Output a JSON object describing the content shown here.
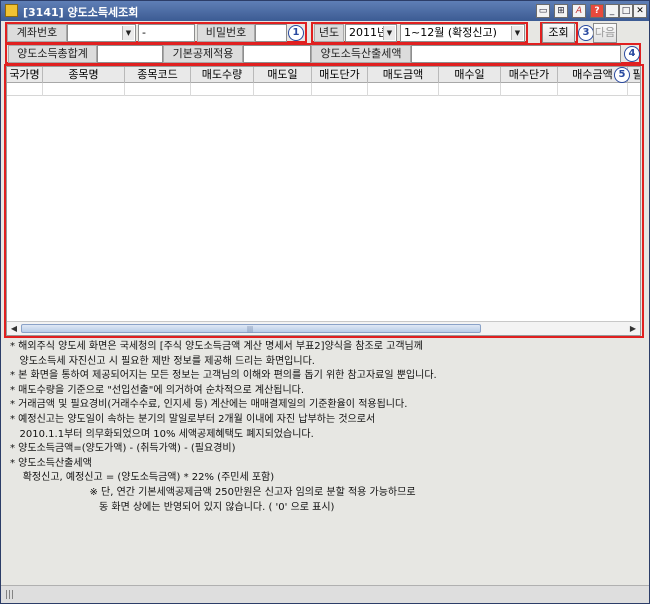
{
  "window": {
    "title": "[3141] 양도소득세조회",
    "buttons": [
      "restore-icon",
      "pin-icon",
      "font-icon",
      "help-icon",
      "minimize-icon",
      "maximize-icon",
      "close-icon"
    ]
  },
  "account": {
    "account_label": "계좌번호",
    "account_value": "",
    "sub_value": "-",
    "password_label": "비밀번호",
    "password_value": "",
    "marker": "1"
  },
  "period": {
    "year_label": "년도",
    "year_value": "2011년",
    "range_value": "1~12월 (확정신고)",
    "marker": "2"
  },
  "actions": {
    "query_label": "조회",
    "next_label": "다음",
    "marker": "3"
  },
  "summary": {
    "total_label": "양도소득총합계",
    "total_value": "",
    "deduction_label": "기본공제적용",
    "deduction_value": "",
    "tax_label": "양도소득산출세액",
    "tax_value": "",
    "marker": "4"
  },
  "grid": {
    "marker": "5",
    "columns": [
      "국가명",
      "종목명",
      "종목코드",
      "매도수량",
      "매도일",
      "매도단가",
      "매도금액",
      "매수일",
      "매수단가",
      "매수금액",
      "필"
    ]
  },
  "notes": [
    "* 해외주식 양도세 화면은 국세청의 [주식 양도소득금액 계산 명세서 부표2]양식을 참조로 고객님께",
    "   양도소득세 자진신고 시 필요한 제반 정보를 제공해 드리는 화면입니다.",
    "* 본 화면을 통하여 제공되어지는 모든 정보는 고객님의 이해와 편의를 돕기 위한 참고자료일 뿐입니다.",
    "* 매도수량을 기준으로 \"선입선출\"에 의거하여 순차적으로 계산됩니다.",
    "* 거래금액 및 필요경비(거래수수료, 인지세 등) 계산에는 매매결제일의 기준환율이 적용됩니다.",
    "* 예정신고는 양도일이 속하는 분기의 말일로부터 2개월 이내에 자진 납부하는 것으로서",
    "   2010.1.1부터 의무화되었으며 10% 세액공제혜택도 폐지되었습니다.",
    "* 양도소득금액=(양도가액) - (취득가액) - (필요경비)",
    "* 양도소득산출세액",
    "    확정신고, 예정신고 = (양도소득금액) * 22% (주민세 포함)",
    "                         ※ 단, 연간 기본세액공제금액 250만원은 신고자 임의로 분할 적용 가능하므로",
    "                            동 화면 상에는 반영되어 있지 않습니다. ( '0' 으로 표시)"
  ],
  "colors": {
    "highlight": "#e02020",
    "marker": "#2a4aa0",
    "titlebar": "#3c5b93"
  }
}
